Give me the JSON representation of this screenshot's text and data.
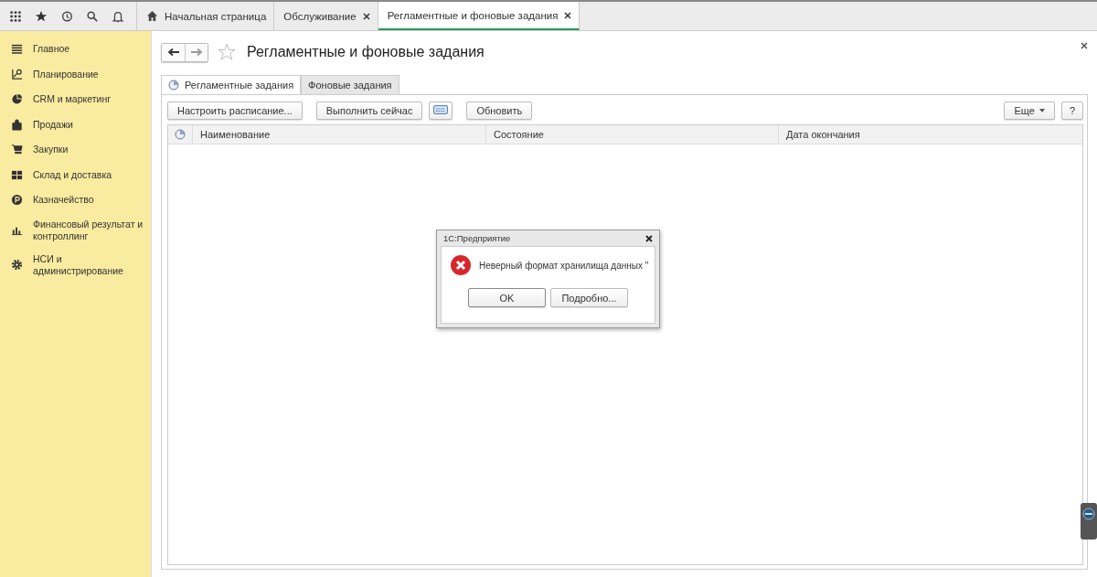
{
  "top_tabs": [
    {
      "label": "Начальная страница",
      "kind": "home",
      "selected": false
    },
    {
      "label": "Обслуживание",
      "kind": "page",
      "selected": false
    },
    {
      "label": "Регламентные и фоновые задания",
      "kind": "page",
      "selected": true
    }
  ],
  "sidebar": {
    "items": [
      {
        "label": "Главное"
      },
      {
        "label": "Планирование"
      },
      {
        "label": "CRM и маркетинг"
      },
      {
        "label": "Продажи"
      },
      {
        "label": "Закупки"
      },
      {
        "label": "Склад и доставка"
      },
      {
        "label": "Казначейство"
      },
      {
        "label": "Финансовый результат и контроллинг"
      },
      {
        "label": "НСИ и администрирование"
      }
    ]
  },
  "form": {
    "title": "Регламентные и фоновые задания",
    "tabs": [
      {
        "label": "Регламентные задания",
        "selected": true
      },
      {
        "label": "Фоновые задания",
        "selected": false
      }
    ],
    "buttons": [
      "Настроить расписание...",
      "Выполнить сейчас"
    ],
    "refresh": "Обновить",
    "more": "Еще",
    "help": "?",
    "table": {
      "columns": [
        "Наименование",
        "Состояние",
        "Дата окончания"
      ]
    }
  },
  "dialog": {
    "title": "1С:Предприятие",
    "message": "Неверный формат хранилища данных \"",
    "buttons": [
      "OK",
      "Подробно..."
    ]
  }
}
